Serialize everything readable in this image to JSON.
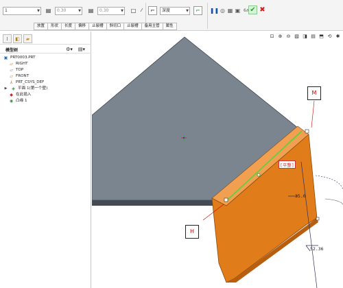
{
  "dashboard": {
    "field_type": "1",
    "field_thick1": "0.30",
    "field_thick2": "0.30",
    "depth_label": "深度",
    "tabs": [
      "放置",
      "形状",
      "长度",
      "偏移",
      "止裂槽",
      "斜切口",
      "止裂槽",
      "备用主管",
      "属性"
    ],
    "colors": {
      "accept": "#2e9e3e",
      "cancel": "#cc1f1f",
      "pause": "#1a50a8"
    }
  },
  "left_panel": {
    "title": "模型树",
    "tree": [
      {
        "label": "PRT0003.PRT",
        "icon": "part-icon"
      },
      {
        "label": "RIGHT",
        "icon": "datum-plane-icon"
      },
      {
        "label": "TOP",
        "icon": "datum-plane-icon"
      },
      {
        "label": "FRONT",
        "icon": "datum-plane-icon"
      },
      {
        "label": "PRT_CSYS_DEF",
        "icon": "csys-icon"
      },
      {
        "label": "平面 1(第一个壁)",
        "icon": "wall-icon"
      },
      {
        "label": "在此插入",
        "icon": "insert-here-icon"
      },
      {
        "label": "凸缘 1",
        "icon": "flange-icon"
      }
    ]
  },
  "viewport": {
    "callout_m": "M",
    "callout_h": "H",
    "dim_width": "52.36",
    "dim_label": "[平整]",
    "dim_small": "35.0",
    "colors": {
      "plate": "#7b8590",
      "flange": "#e07c1a",
      "edge": "#5bd23a",
      "callout_text": "#cc0000"
    }
  }
}
